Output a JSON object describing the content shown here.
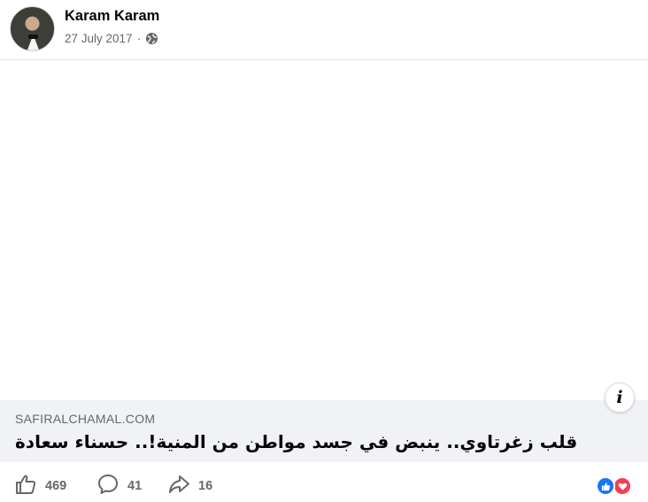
{
  "post": {
    "author": "Karam Karam",
    "date": "27 July 2017",
    "separator": "·",
    "audience_icon": "globe-icon"
  },
  "link": {
    "domain": "SAFIRALCHAMAL.COM",
    "title": "قلب زغرتاوي.. ينبض في جسد مواطن من المنية!.. حسناء سعادة",
    "info_icon": "info-icon",
    "info_glyph": "i"
  },
  "actions": {
    "likes": "469",
    "comments": "41",
    "shares": "16",
    "reaction_icons": [
      "like-reaction-icon",
      "love-reaction-icon"
    ]
  },
  "colors": {
    "like": "#1877f2",
    "love": "#f33e58",
    "secondary_text": "#65676b"
  }
}
